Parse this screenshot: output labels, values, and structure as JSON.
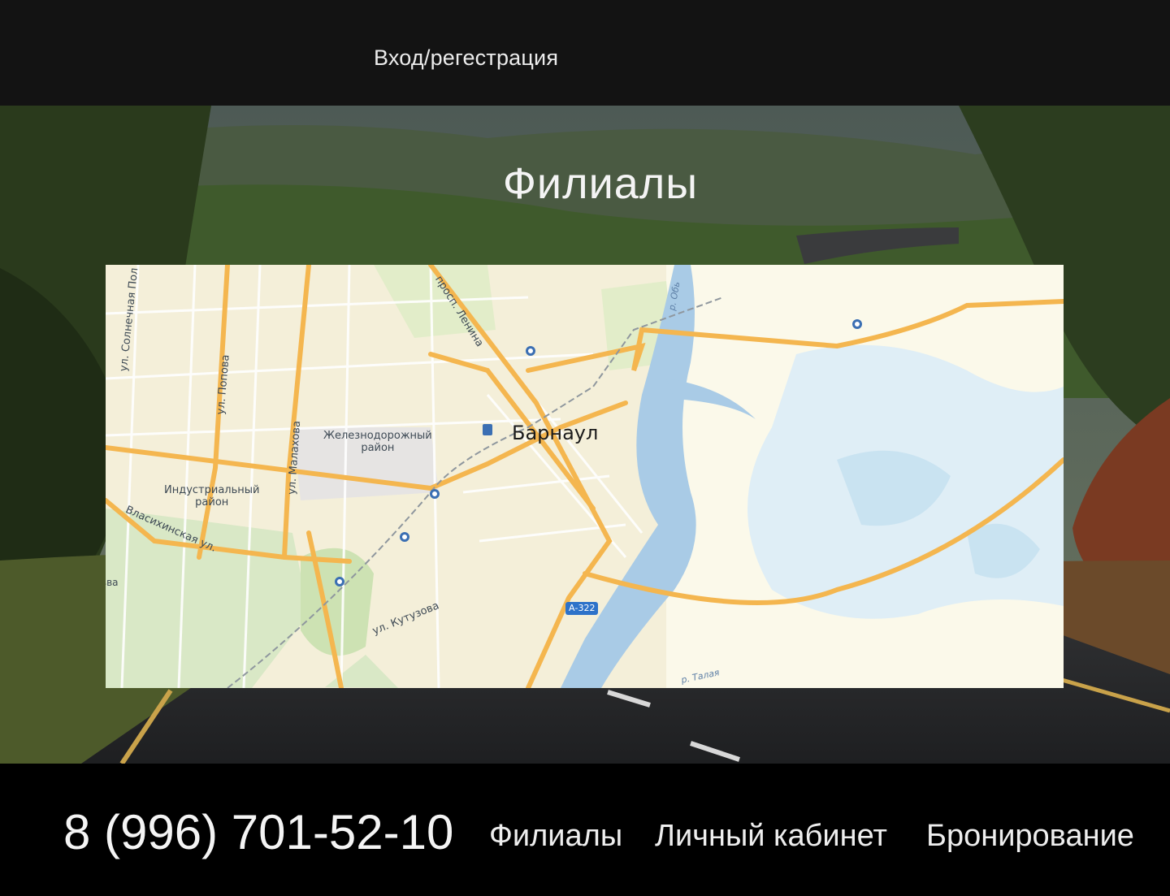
{
  "header": {
    "login_label": "Вход/регестрация"
  },
  "hero": {
    "title": "Филиалы"
  },
  "map": {
    "city": "Барнаул",
    "districts": [
      "Железнодорожный\nрайон",
      "Индустриальный\nрайон"
    ],
    "streets": [
      "ул. Солнечная Пол",
      "ул. Попова",
      "ул. Малахова",
      "просп. Ленина",
      "Власихинская ул.",
      "ул. Кутузова",
      "р. Обь",
      "р. Талая",
      "вва"
    ],
    "road_badge": "А-322"
  },
  "footer": {
    "phone": "8 (996) 701-52-10",
    "nav": [
      "Филиалы",
      "Личный кабинет",
      "Бронирование"
    ]
  }
}
